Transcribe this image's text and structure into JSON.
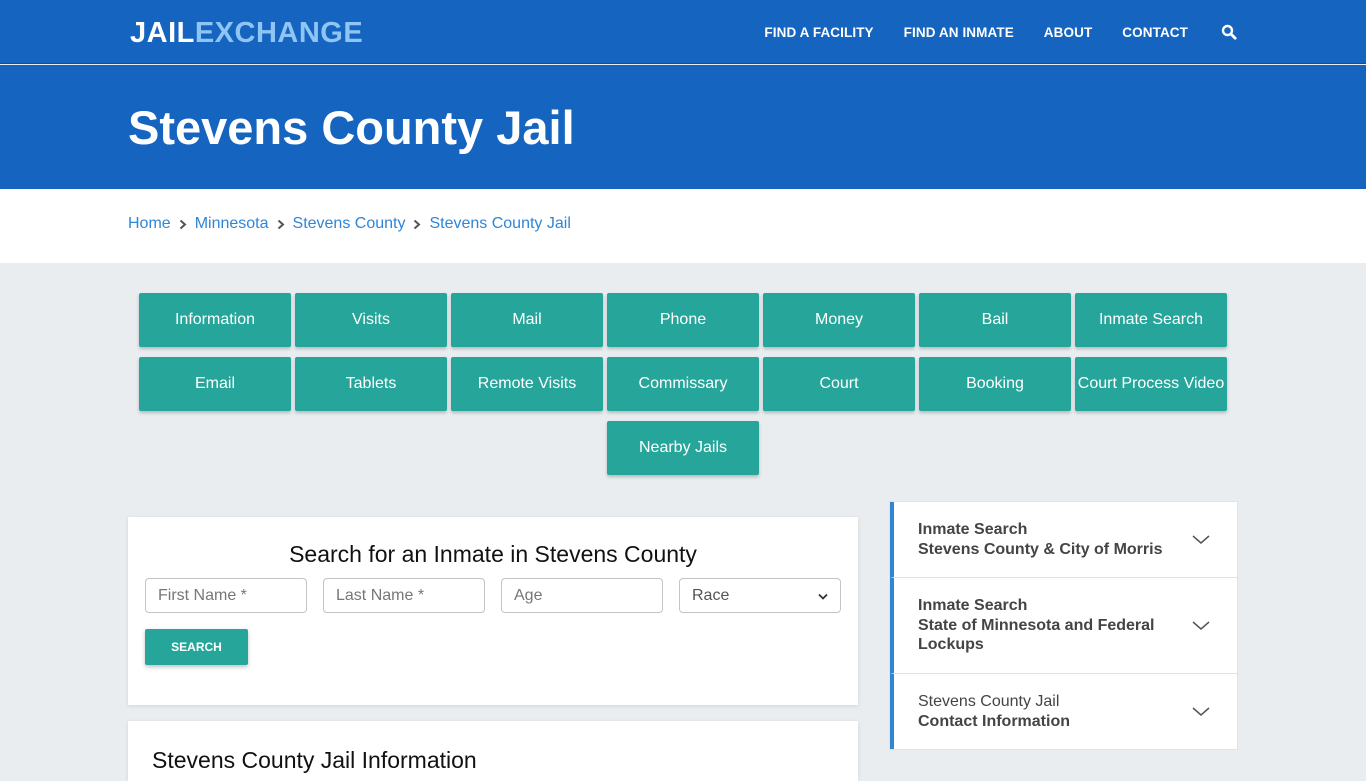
{
  "brand": {
    "part1": "JAIL",
    "part2": "EXCHANGE"
  },
  "nav": {
    "items": [
      "FIND A FACILITY",
      "FIND AN INMATE",
      "ABOUT",
      "CONTACT"
    ],
    "search_icon": "search-icon"
  },
  "hero": {
    "title": "Stevens County Jail"
  },
  "breadcrumb": [
    "Home",
    "Minnesota",
    "Stevens County",
    "Stevens County Jail"
  ],
  "tiles": {
    "row1": [
      "Information",
      "Visits",
      "Mail",
      "Phone",
      "Money",
      "Bail",
      "Inmate Search"
    ],
    "row2": [
      "Email",
      "Tablets",
      "Remote Visits",
      "Commissary",
      "Court",
      "Booking",
      "Court Process Video"
    ],
    "row3": [
      "Nearby Jails"
    ]
  },
  "search_form": {
    "title": "Search for an Inmate in Stevens County",
    "first_name_placeholder": "First Name *",
    "last_name_placeholder": "Last Name *",
    "age_placeholder": "Age",
    "race_selected": "Race",
    "submit_label": "SEARCH"
  },
  "info_section": {
    "title": "Stevens County Jail Information"
  },
  "accordion": [
    {
      "line1": "Inmate Search",
      "line2": "Stevens County & City of Morris",
      "line1_bold": true
    },
    {
      "line1": "Inmate Search",
      "line2": "State of Minnesota and Federal Lockups",
      "line1_bold": true
    },
    {
      "line1": "Stevens County Jail",
      "line2": "Contact Information",
      "line1_bold": false
    }
  ],
  "colors": {
    "primary_blue": "#1565c0",
    "logo_accent": "#8ec5f5",
    "teal": "#26a69a",
    "link_blue": "#2f86d6",
    "page_bg": "#e9edf0"
  }
}
